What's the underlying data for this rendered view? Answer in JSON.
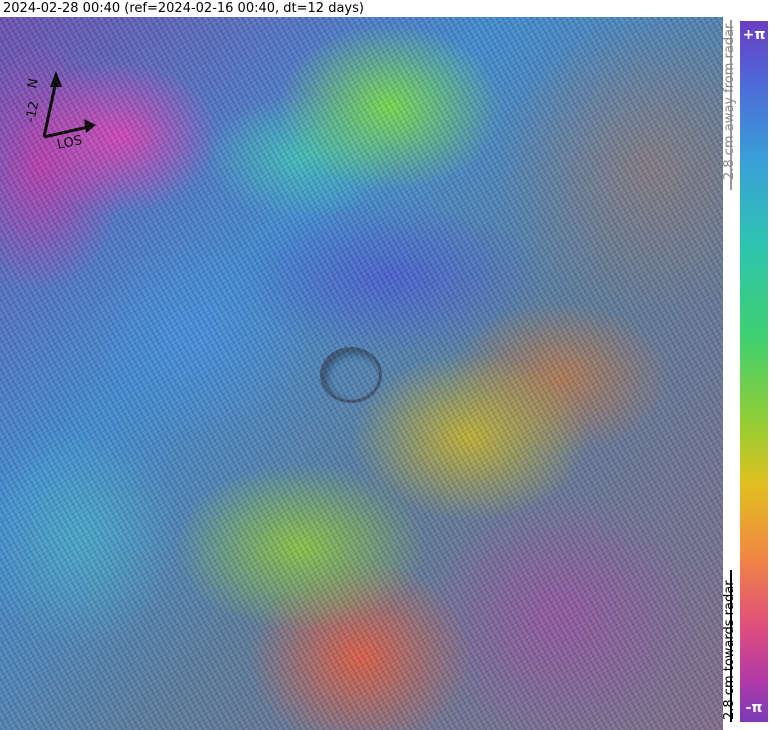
{
  "title": "2024-02-28 00:40 (ref=2024-02-16 00:40, dt=12 days)",
  "compass": {
    "north_label": "N",
    "heading_label": "-12",
    "los_label": "LOS"
  },
  "colorbar": {
    "top_label": "+π",
    "bottom_label": "-π",
    "away_label": "2.8 cm away from radar",
    "towards_label": "2.8 cm towards radar",
    "colors": [
      "#6a3ec2",
      "#4b6fd8",
      "#3aa0d8",
      "#2ec4b0",
      "#3ed070",
      "#9acd32",
      "#e0c020",
      "#f08a40",
      "#e0507a",
      "#b23aa8"
    ]
  }
}
